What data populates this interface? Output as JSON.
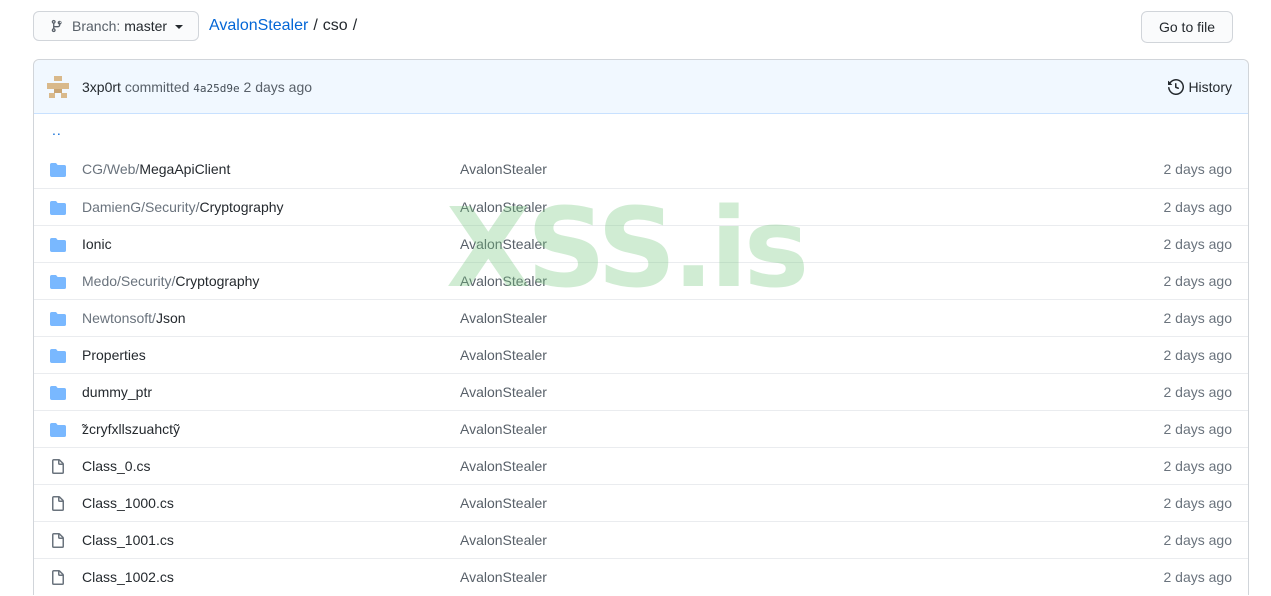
{
  "branch": {
    "label": "Branch:",
    "value": "master"
  },
  "breadcrumb": {
    "repo": "AvalonStealer",
    "sep1": "/",
    "dir": "cso",
    "sep2": "/"
  },
  "goto_file": "Go to file",
  "commit": {
    "author": "3xp0rt",
    "verb": "committed",
    "sha": "4a25d9e",
    "time": "2 days ago"
  },
  "history": "History",
  "up_dir": "..",
  "rows": [
    {
      "type": "dir",
      "prefix": "CG/Web/",
      "name": "MegaApiClient",
      "message": "AvalonStealer",
      "age": "2 days ago"
    },
    {
      "type": "dir",
      "prefix": "DamienG/Security/",
      "name": "Cryptography",
      "message": "AvalonStealer",
      "age": "2 days ago"
    },
    {
      "type": "dir",
      "prefix": "",
      "name": "Ionic",
      "message": "AvalonStealer",
      "age": "2 days ago"
    },
    {
      "type": "dir",
      "prefix": "Medo/Security/",
      "name": "Cryptography",
      "message": "AvalonStealer",
      "age": "2 days ago"
    },
    {
      "type": "dir",
      "prefix": "Newtonsoft/",
      "name": "Json",
      "message": "AvalonStealer",
      "age": "2 days ago"
    },
    {
      "type": "dir",
      "prefix": "",
      "name": "Properties",
      "message": "AvalonStealer",
      "age": "2 days ago"
    },
    {
      "type": "dir",
      "prefix": "",
      "name": "dummy_ptr",
      "message": "AvalonStealer",
      "age": "2 days ago"
    },
    {
      "type": "dir",
      "prefix": "",
      "name": "̃zcryfxllszuahctỹ",
      "message": "AvalonStealer",
      "age": "2 days ago"
    },
    {
      "type": "file",
      "prefix": "",
      "name": "Class_0.cs",
      "message": "AvalonStealer",
      "age": "2 days ago"
    },
    {
      "type": "file",
      "prefix": "",
      "name": "Class_1000.cs",
      "message": "AvalonStealer",
      "age": "2 days ago"
    },
    {
      "type": "file",
      "prefix": "",
      "name": "Class_1001.cs",
      "message": "AvalonStealer",
      "age": "2 days ago"
    },
    {
      "type": "file",
      "prefix": "",
      "name": "Class_1002.cs",
      "message": "AvalonStealer",
      "age": "2 days ago"
    }
  ],
  "watermark": "XSS.is",
  "colors": {
    "link": "#0366d6",
    "folder": "#79b8ff",
    "commit_bg": "#f1f8ff",
    "watermark": "#78c882"
  }
}
